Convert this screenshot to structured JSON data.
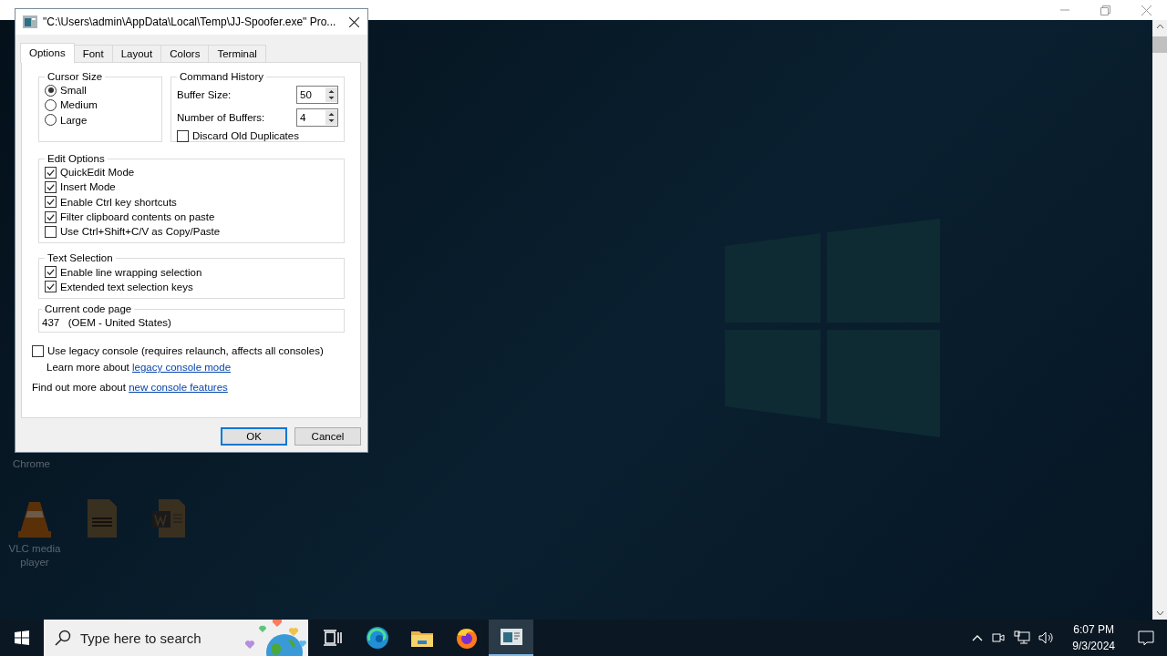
{
  "dialog": {
    "title": "\"C:\\Users\\admin\\AppData\\Local\\Temp\\JJ-Spoofer.exe\" Pro...",
    "tabs": [
      {
        "label": "Options",
        "selected": true
      },
      {
        "label": "Font",
        "selected": false
      },
      {
        "label": "Layout",
        "selected": false
      },
      {
        "label": "Colors",
        "selected": false
      },
      {
        "label": "Terminal",
        "selected": false
      }
    ],
    "cursor_size": {
      "title": "Cursor Size",
      "options": [
        {
          "label": "Small",
          "selected": true
        },
        {
          "label": "Medium",
          "selected": false
        },
        {
          "label": "Large",
          "selected": false
        }
      ]
    },
    "command_history": {
      "title": "Command History",
      "spinners": [
        {
          "label": "Buffer Size:",
          "value": "50"
        },
        {
          "label": "Number of Buffers:",
          "value": "4"
        }
      ],
      "discard": {
        "label": "Discard Old Duplicates",
        "checked": false
      }
    },
    "edit_options": {
      "title": "Edit Options",
      "items": [
        {
          "label": "QuickEdit Mode",
          "checked": true
        },
        {
          "label": "Insert Mode",
          "checked": true
        },
        {
          "label": "Enable Ctrl key shortcuts",
          "checked": true
        },
        {
          "label": "Filter clipboard contents on paste",
          "checked": true
        },
        {
          "label": "Use Ctrl+Shift+C/V as Copy/Paste",
          "checked": false
        }
      ]
    },
    "text_selection": {
      "title": "Text Selection",
      "items": [
        {
          "label": "Enable line wrapping selection",
          "checked": true
        },
        {
          "label": "Extended text selection keys",
          "checked": true
        }
      ]
    },
    "code_page": {
      "title": "Current code page",
      "value": "437   (OEM - United States)"
    },
    "legacy": {
      "label": "Use legacy console (requires relaunch, affects all consoles)",
      "checked": false
    },
    "learn_more": {
      "text": "Learn more about",
      "link": "legacy console mode"
    },
    "find_out": {
      "text": "Find out more about",
      "link": "new console features"
    },
    "buttons": [
      {
        "label": "OK",
        "default": true
      },
      {
        "label": "Cancel",
        "default": false
      }
    ]
  },
  "desktop_icons": [
    {
      "kind": "label-only",
      "label": "Chrome"
    },
    {
      "kind": "vlc",
      "label": "VLC media player"
    },
    {
      "kind": "document"
    },
    {
      "kind": "word"
    }
  ],
  "taskbar": {
    "search_placeholder": "Type here to search",
    "apps": [
      {
        "kind": "task-view",
        "active": false
      },
      {
        "kind": "edge",
        "active": false
      },
      {
        "kind": "explorer",
        "active": false
      },
      {
        "kind": "firefox",
        "active": false
      },
      {
        "kind": "console",
        "active": true
      }
    ],
    "time": "6:07 PM",
    "date": "9/3/2024"
  }
}
